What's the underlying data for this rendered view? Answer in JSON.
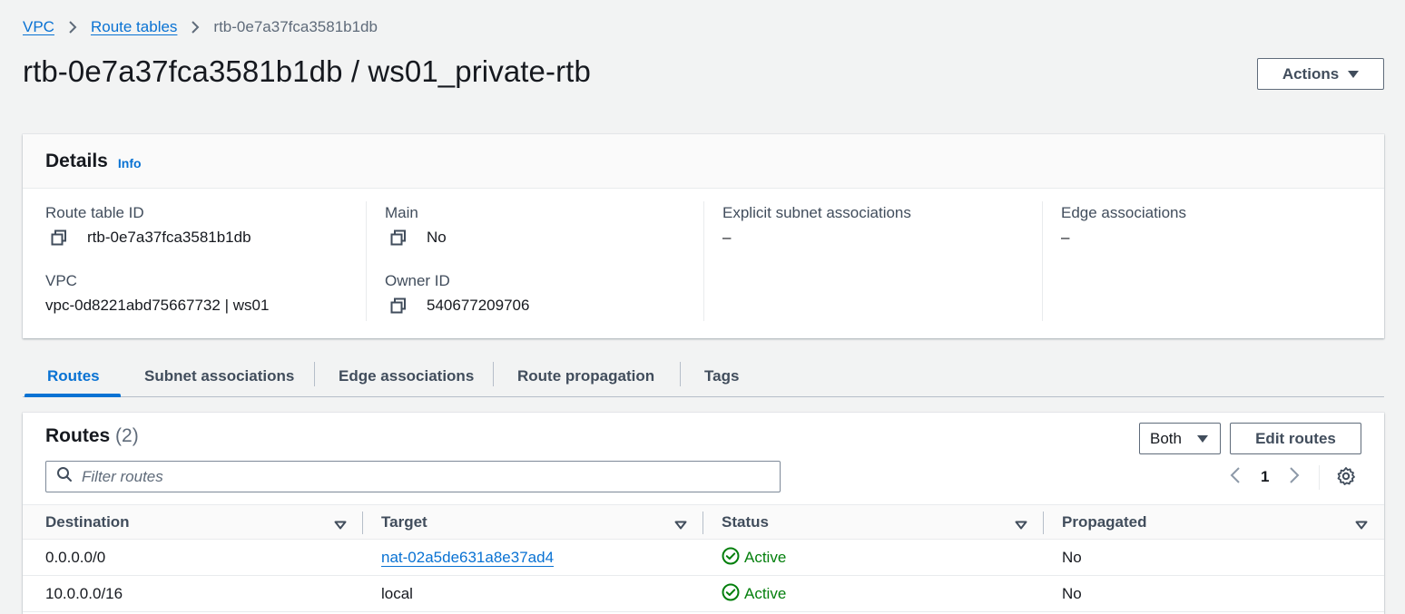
{
  "breadcrumb": {
    "items": [
      "VPC",
      "Route tables"
    ],
    "current": "rtb-0e7a37fca3581b1db"
  },
  "page": {
    "title": "rtb-0e7a37fca3581b1db / ws01_private-rtb",
    "actions_label": "Actions"
  },
  "details": {
    "title": "Details",
    "info_label": "Info",
    "route_table_id_label": "Route table ID",
    "route_table_id": "rtb-0e7a37fca3581b1db",
    "vpc_label": "VPC",
    "vpc_value": "vpc-0d8221abd75667732 | ws01",
    "main_label": "Main",
    "main_value": "No",
    "owner_id_label": "Owner ID",
    "owner_id": "540677209706",
    "explicit_label": "Explicit subnet associations",
    "explicit_value": "–",
    "edge_label": "Edge associations",
    "edge_value": "–"
  },
  "tabs": [
    {
      "label": "Routes",
      "active": true
    },
    {
      "label": "Subnet associations",
      "active": false
    },
    {
      "label": "Edge associations",
      "active": false
    },
    {
      "label": "Route propagation",
      "active": false
    },
    {
      "label": "Tags",
      "active": false
    }
  ],
  "routes": {
    "title": "Routes",
    "count": "(2)",
    "filter_select": "Both",
    "edit_label": "Edit routes",
    "filter_placeholder": "Filter routes",
    "page_number": "1",
    "columns": [
      "Destination",
      "Target",
      "Status",
      "Propagated"
    ],
    "rows": [
      {
        "destination": "0.0.0.0/0",
        "target": "nat-02a5de631a8e37ad4",
        "status": "Active",
        "propagated": "No"
      },
      {
        "destination": "10.0.0.0/16",
        "target": "local",
        "status": "Active",
        "propagated": "No"
      }
    ]
  },
  "colors": {
    "link": "#0972d3",
    "success": "#037f0c",
    "background": "#f2f3f3"
  }
}
